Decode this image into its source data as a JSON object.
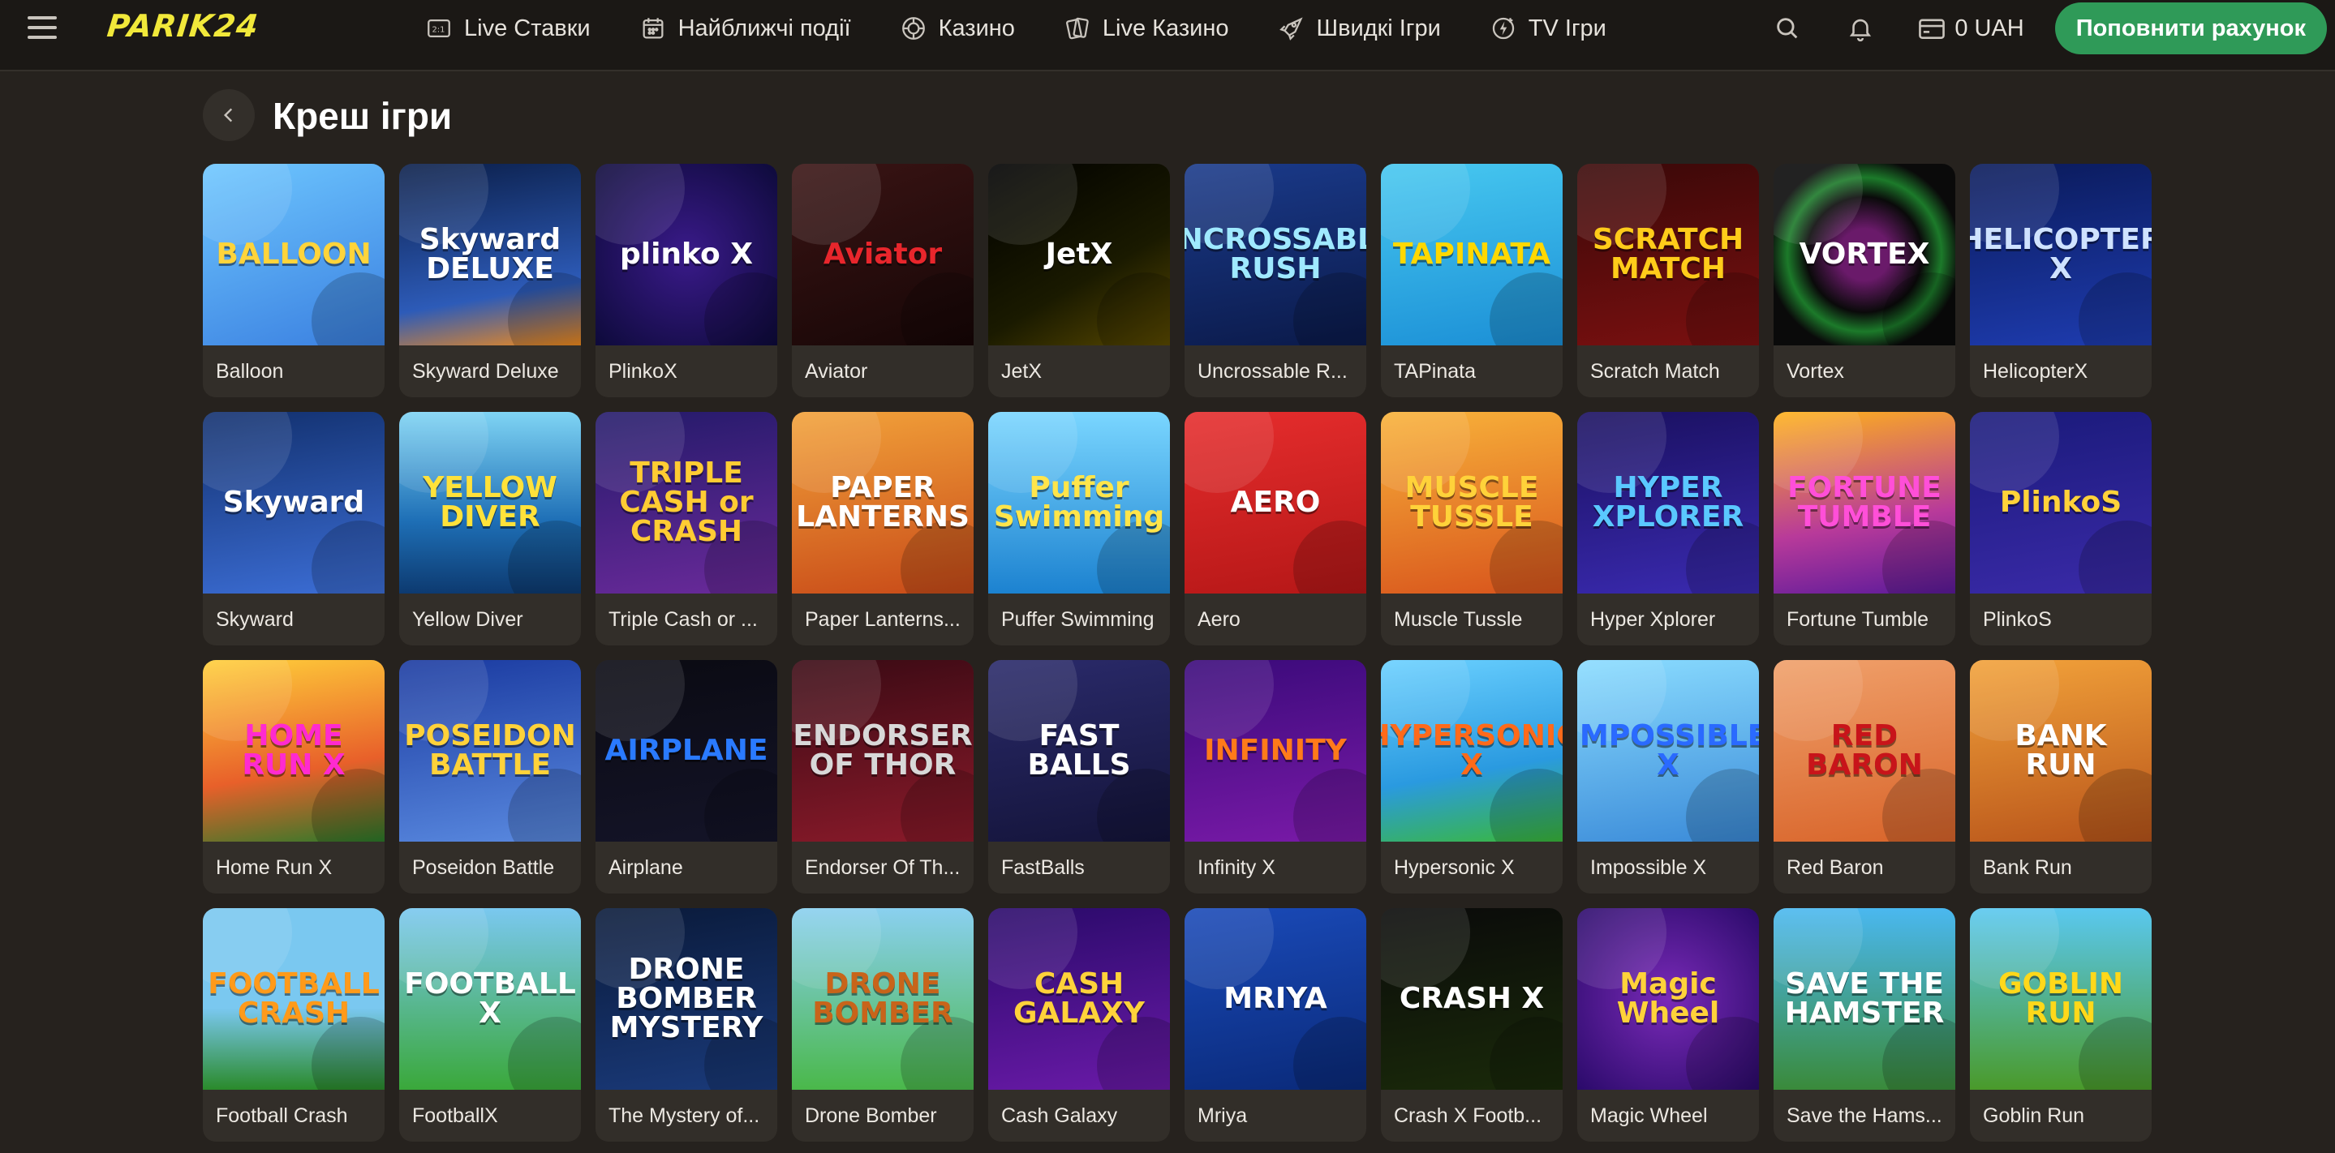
{
  "brand": {
    "logo_text": "PARIK24",
    "accent": "#f1e83a",
    "cta_color": "#2f9a58"
  },
  "nav": [
    {
      "label": "Live Ставки",
      "icon": "scoreboard-icon"
    },
    {
      "label": "Найближчі події",
      "icon": "calendar-icon"
    },
    {
      "label": "Казино",
      "icon": "casino-chip-icon"
    },
    {
      "label": "Live Казино",
      "icon": "cards-icon"
    },
    {
      "label": "Швидкі Ігри",
      "icon": "rocket-icon"
    },
    {
      "label": "TV Ігри",
      "icon": "tv-games-icon"
    }
  ],
  "header": {
    "balance": "0 UAH",
    "deposit_label": "Поповнити рахунок"
  },
  "page": {
    "title": "Креш ігри"
  },
  "games": [
    {
      "name": "Balloon",
      "art": "BALLOON",
      "bg": "linear-gradient(160deg,#6ec7ff,#3a7fe0)",
      "fg": "#ffd43b"
    },
    {
      "name": "Skyward Deluxe",
      "art": "Skyward DELUXE",
      "bg": "linear-gradient(170deg,#0b1f4a,#2d5bb8 70%,#f08a1c)",
      "fg": "#ffffff"
    },
    {
      "name": "PlinkoX",
      "art": "plinko X",
      "bg": "radial-gradient(circle,#3a1a8a,#0d0a3a)",
      "fg": "#ffffff"
    },
    {
      "name": "Aviator",
      "art": "Aviator",
      "bg": "linear-gradient(160deg,#3a1414,#160606)",
      "fg": "#e8262c"
    },
    {
      "name": "JetX",
      "art": "JetX",
      "bg": "linear-gradient(150deg,#000000,#1a1a00 60%,#5a4a00)",
      "fg": "#ffffff"
    },
    {
      "name": "Uncrossable R...",
      "art": "UNCROSSABLE RUSH",
      "bg": "linear-gradient(170deg,#1a3a8a,#0b1a4a)",
      "fg": "#9fe9ff"
    },
    {
      "name": "TAPinata",
      "art": "TAPINATA",
      "bg": "linear-gradient(170deg,#47c8f0,#1b8fd6)",
      "fg": "#ffd800"
    },
    {
      "name": "Scratch Match",
      "art": "SCRATCH MATCH",
      "bg": "linear-gradient(170deg,#3a0808,#7a1010)",
      "fg": "#ffcc1a"
    },
    {
      "name": "Vortex",
      "art": "VORTEX",
      "bg": "radial-gradient(circle,#6a1a6a 20%,#0a0a0a 45%,#1c7a2a 60%,#0a0a0a 75%)",
      "fg": "#ffffff"
    },
    {
      "name": "HelicopterX",
      "art": "HELICOPTER X",
      "bg": "linear-gradient(170deg,#0a1a5a,#1e3cb0)",
      "fg": "#cfe2ff"
    },
    {
      "name": "Skyward",
      "art": "Skyward",
      "bg": "linear-gradient(170deg,#12306e,#3c6ed6)",
      "fg": "#ffffff"
    },
    {
      "name": "Yellow Diver",
      "art": "YELLOW DIVER",
      "bg": "linear-gradient(180deg,#7fd4f4,#1e6fb6 60%,#0d3a70)",
      "fg": "#ffe23a"
    },
    {
      "name": "Triple Cash or ...",
      "art": "TRIPLE CASH or CRASH",
      "bg": "linear-gradient(170deg,#241a6a,#6a2a9a)",
      "fg": "#ffcc33"
    },
    {
      "name": "Paper Lanterns...",
      "art": "PAPER LANTERNS",
      "bg": "linear-gradient(170deg,#f2a23a,#c84a18)",
      "fg": "#ffffff"
    },
    {
      "name": "Puffer Swimming",
      "art": "Puffer Swimming",
      "bg": "linear-gradient(180deg,#7ad6ff,#1c82d0)",
      "fg": "#ffe54a"
    },
    {
      "name": "Aero",
      "art": "AERO",
      "bg": "linear-gradient(170deg,#e62d2d,#b51717)",
      "fg": "#ffffff"
    },
    {
      "name": "Muscle Tussle",
      "art": "MUSCLE TUSSLE",
      "bg": "linear-gradient(170deg,#f8b23a,#d8541c)",
      "fg": "#ffd23a"
    },
    {
      "name": "Hyper Xplorer",
      "art": "HYPER XPLORER",
      "bg": "linear-gradient(170deg,#1a1060,#3a2ab0)",
      "fg": "#5ac8ff"
    },
    {
      "name": "Fortune Tumble",
      "art": "FORTUNE TUMBLE",
      "bg": "linear-gradient(170deg,#ffb21a,#b83a9a 60%,#5a1a9a)",
      "fg": "#ff4fd8"
    },
    {
      "name": "PlinkoS",
      "art": "PlinkoS",
      "bg": "linear-gradient(170deg,#1a1a7a,#3a2aa8)",
      "fg": "#ffd23a"
    },
    {
      "name": "Home Run X",
      "art": "HOME RUN X",
      "bg": "linear-gradient(170deg,#ffcf3a,#e8602a 60%,#2a7a2a)",
      "fg": "#ff2ad0"
    },
    {
      "name": "Poseidon Battle",
      "art": "POSEIDON BATTLE",
      "bg": "linear-gradient(170deg,#1a3aa0,#5a8ae0)",
      "fg": "#ffd23a"
    },
    {
      "name": "Airplane",
      "art": "AIRPLANE",
      "bg": "linear-gradient(170deg,#0a0a12,#141428)",
      "fg": "#2a7aff"
    },
    {
      "name": "Endorser Of Th...",
      "art": "ENDORSER OF THOR",
      "bg": "linear-gradient(170deg,#3a0a14,#8a1a2a)",
      "fg": "#d8d8d8"
    },
    {
      "name": "FastBalls",
      "art": "FAST BALLS",
      "bg": "linear-gradient(170deg,#2a2a6a,#14143a)",
      "fg": "#ffffff"
    },
    {
      "name": "Infinity X",
      "art": "INFINITY",
      "bg": "linear-gradient(170deg,#3a0a7a,#7a1aa8)",
      "fg": "#ff7a1a"
    },
    {
      "name": "Hypersonic X",
      "art": "HYPERSONIC X",
      "bg": "linear-gradient(170deg,#6ad0ff,#2a9ae0 60%,#3ab83a)",
      "fg": "#ff6a1a"
    },
    {
      "name": "Impossible X",
      "art": "IMPOSSIBLE X",
      "bg": "linear-gradient(170deg,#8adcff,#3a8ad8)",
      "fg": "#2a6aff"
    },
    {
      "name": "Red Baron",
      "art": "RED BARON",
      "bg": "linear-gradient(170deg,#f0a06a,#d8642a)",
      "fg": "#c8141a"
    },
    {
      "name": "Bank Run",
      "art": "BANK RUN",
      "bg": "linear-gradient(170deg,#f2a23a,#b8541a)",
      "fg": "#ffffff"
    },
    {
      "name": "Football Crash",
      "art": "FOOTBALL CRASH",
      "bg": "linear-gradient(180deg,#7ac8f0 55%,#2a8a2a)",
      "fg": "#ff9a1a"
    },
    {
      "name": "FootballX",
      "art": "FOOTBALL X",
      "bg": "linear-gradient(180deg,#7ac8f0,#3aa83a)",
      "fg": "#ffffff"
    },
    {
      "name": "The Mystery of...",
      "art": "DRONE BOMBER MYSTERY",
      "bg": "linear-gradient(170deg,#0a1a3a,#1a3a7a)",
      "fg": "#ffffff"
    },
    {
      "name": "Drone Bomber",
      "art": "DRONE BOMBER",
      "bg": "linear-gradient(180deg,#8ad0f0,#4ab84a)",
      "fg": "#c8641a"
    },
    {
      "name": "Cash Galaxy",
      "art": "CASH GALAXY",
      "bg": "linear-gradient(170deg,#2a0a6a,#6a1aa8)",
      "fg": "#ffd23a"
    },
    {
      "name": "Mriya",
      "art": "MRIYA",
      "bg": "linear-gradient(170deg,#1a4ab8,#0a2a7a)",
      "fg": "#ffffff"
    },
    {
      "name": "Crash X Footb...",
      "art": "CRASH X",
      "bg": "linear-gradient(170deg,#0a0a0a,#1a2a0a)",
      "fg": "#ffffff"
    },
    {
      "name": "Magic Wheel",
      "art": "Magic Wheel",
      "bg": "radial-gradient(circle,#7a2ab8,#2a0a6a)",
      "fg": "#ffd23a"
    },
    {
      "name": "Save the Hams...",
      "art": "SAVE THE HAMSTER",
      "bg": "linear-gradient(180deg,#4ab8f0,#3a8a3a)",
      "fg": "#ffffff"
    },
    {
      "name": "Goblin Run",
      "art": "GOBLIN RUN",
      "bg": "linear-gradient(180deg,#5ac8f0,#4a9a2a)",
      "fg": "#ffd81a"
    }
  ]
}
